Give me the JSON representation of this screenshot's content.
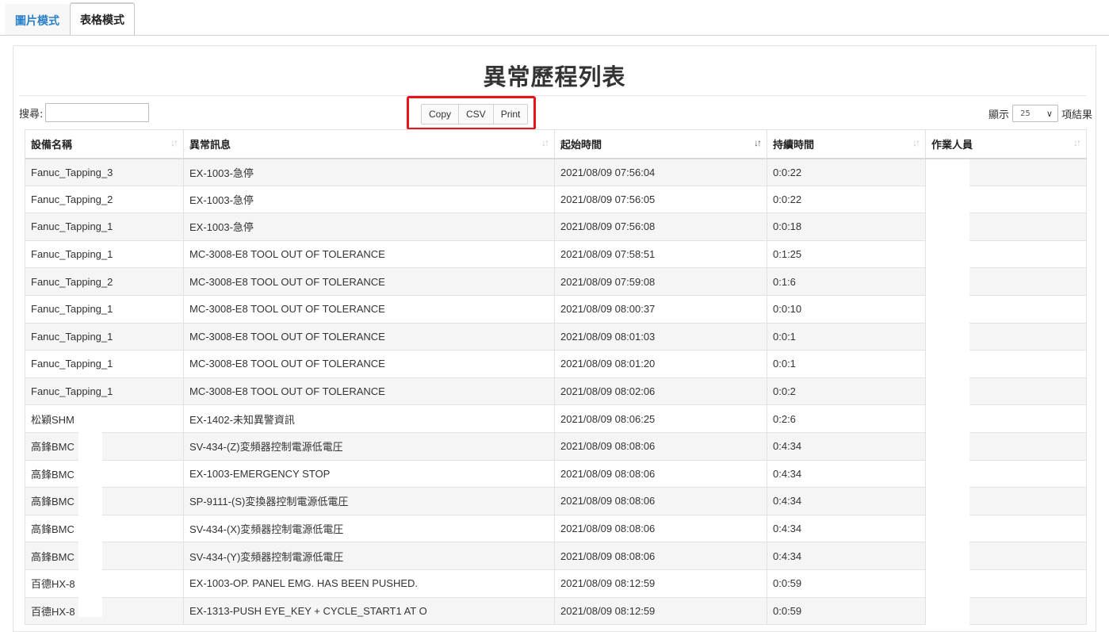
{
  "tabs": [
    {
      "label": "圖片模式",
      "active": false
    },
    {
      "label": "表格模式",
      "active": true
    }
  ],
  "title": "異常歷程列表",
  "search": {
    "label": "搜尋:",
    "value": ""
  },
  "buttons": {
    "copy": "Copy",
    "csv": "CSV",
    "print": "Print"
  },
  "length": {
    "prefix": "顯示",
    "value": "25",
    "suffix": "項結果"
  },
  "columns": [
    "設備名稱",
    "異常訊息",
    "起始時間",
    "持續時間",
    "作業人員"
  ],
  "sorted_column": "起始時間",
  "rows": [
    [
      "Fanuc_Tapping_3",
      "EX-1003-急停",
      "2021/08/09 07:56:04",
      "0:0:22",
      ""
    ],
    [
      "Fanuc_Tapping_2",
      "EX-1003-急停",
      "2021/08/09 07:56:05",
      "0:0:22",
      ""
    ],
    [
      "Fanuc_Tapping_1",
      "EX-1003-急停",
      "2021/08/09 07:56:08",
      "0:0:18",
      ""
    ],
    [
      "Fanuc_Tapping_1",
      "MC-3008-E8 TOOL OUT OF TOLERANCE",
      "2021/08/09 07:58:51",
      "0:1:25",
      ""
    ],
    [
      "Fanuc_Tapping_2",
      "MC-3008-E8 TOOL OUT OF TOLERANCE",
      "2021/08/09 07:59:08",
      "0:1:6",
      ""
    ],
    [
      "Fanuc_Tapping_1",
      "MC-3008-E8 TOOL OUT OF TOLERANCE",
      "2021/08/09 08:00:37",
      "0:0:10",
      ""
    ],
    [
      "Fanuc_Tapping_1",
      "MC-3008-E8 TOOL OUT OF TOLERANCE",
      "2021/08/09 08:01:03",
      "0:0:1",
      ""
    ],
    [
      "Fanuc_Tapping_1",
      "MC-3008-E8 TOOL OUT OF TOLERANCE",
      "2021/08/09 08:01:20",
      "0:0:1",
      ""
    ],
    [
      "Fanuc_Tapping_1",
      "MC-3008-E8 TOOL OUT OF TOLERANCE",
      "2021/08/09 08:02:06",
      "0:0:2",
      ""
    ],
    [
      "松穎SHM",
      "EX-1402-未知異警資訊",
      "2021/08/09 08:06:25",
      "0:2:6",
      ""
    ],
    [
      "高鋒BMC",
      "SV-434-(Z)変頻器控制電源低電圧",
      "2021/08/09 08:08:06",
      "0:4:34",
      ""
    ],
    [
      "高鋒BMC",
      "EX-1003-EMERGENCY STOP",
      "2021/08/09 08:08:06",
      "0:4:34",
      ""
    ],
    [
      "高鋒BMC",
      "SP-9111-(S)変換器控制電源低電圧",
      "2021/08/09 08:08:06",
      "0:4:34",
      ""
    ],
    [
      "高鋒BMC",
      "SV-434-(X)変頻器控制電源低電圧",
      "2021/08/09 08:08:06",
      "0:4:34",
      ""
    ],
    [
      "高鋒BMC",
      "SV-434-(Y)変頻器控制電源低電圧",
      "2021/08/09 08:08:06",
      "0:4:34",
      ""
    ],
    [
      "百德HX-8",
      "EX-1003-OP. PANEL EMG. HAS BEEN PUSHED.",
      "2021/08/09 08:12:59",
      "0:0:59",
      ""
    ],
    [
      "百德HX-8",
      "EX-1313-PUSH EYE_KEY + CYCLE_START1 AT O",
      "2021/08/09 08:12:59",
      "0:0:59",
      ""
    ]
  ]
}
